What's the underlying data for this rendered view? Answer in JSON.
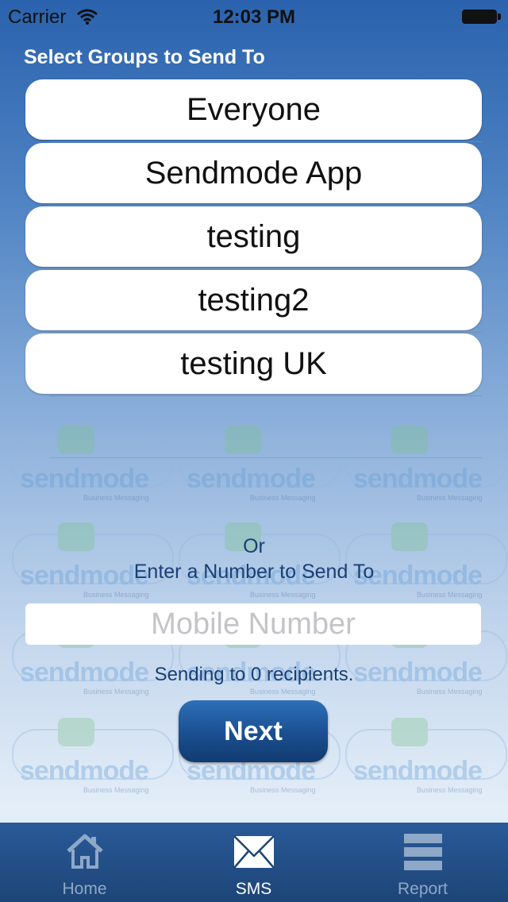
{
  "status_bar": {
    "carrier": "Carrier",
    "time": "12:03 PM"
  },
  "groups_title": "Select Groups to Send To",
  "groups": [
    "Everyone",
    "Sendmode App",
    "testing",
    "testing2",
    "testing UK"
  ],
  "or_label": "Or",
  "enter_number_label": "Enter a Number to Send To",
  "mobile_input": {
    "placeholder": "Mobile Number",
    "value": ""
  },
  "recipients_text": "Sending to 0 recipients.",
  "next_label": "Next",
  "watermark": {
    "brand": "sendmode",
    "tagline": "Business Messaging",
    "bubble": "SMS"
  },
  "tabs": [
    {
      "label": "Home",
      "icon": "home-icon",
      "active": false
    },
    {
      "label": "SMS",
      "icon": "envelope-icon",
      "active": true
    },
    {
      "label": "Report",
      "icon": "report-icon",
      "active": false
    }
  ],
  "colors": {
    "tab_bar": "#1d4577",
    "button": "#1a4f90",
    "text_dark": "#1a3f74"
  }
}
